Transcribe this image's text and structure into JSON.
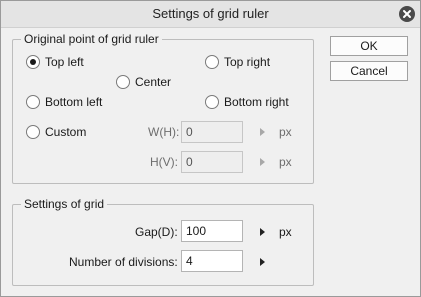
{
  "window": {
    "title": "Settings of grid ruler"
  },
  "origin_group": {
    "legend": "Original point of grid ruler",
    "options": {
      "top_left": {
        "label": "Top left",
        "checked": true
      },
      "top_right": {
        "label": "Top right",
        "checked": false
      },
      "center": {
        "label": "Center",
        "checked": false
      },
      "bottom_left": {
        "label": "Bottom left",
        "checked": false
      },
      "bottom_right": {
        "label": "Bottom right",
        "checked": false
      },
      "custom": {
        "label": "Custom",
        "checked": false
      }
    },
    "w_label": "W(H):",
    "w_value": "0",
    "w_unit": "px",
    "h_label": "H(V):",
    "h_value": "0",
    "h_unit": "px"
  },
  "grid_group": {
    "legend": "Settings of grid",
    "gap_label": "Gap(D):",
    "gap_value": "100",
    "gap_unit": "px",
    "divisions_label": "Number of divisions:",
    "divisions_value": "4"
  },
  "buttons": {
    "ok": "OK",
    "cancel": "Cancel"
  },
  "icons": {
    "close": "close-icon",
    "arrow": "right-triangle-icon"
  }
}
